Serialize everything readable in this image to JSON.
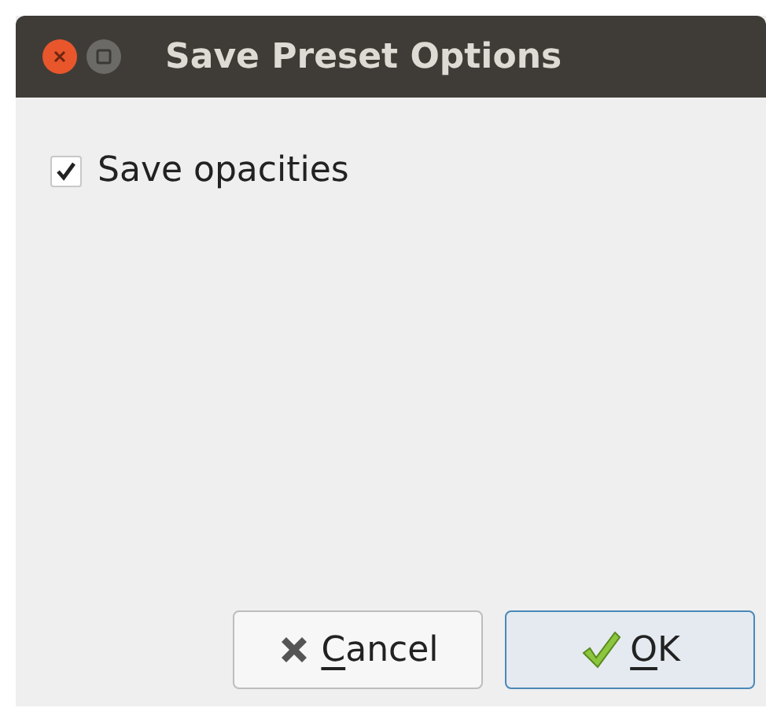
{
  "window": {
    "title": "Save Preset Options"
  },
  "options": [
    {
      "label": "Save opacities",
      "checked": true
    }
  ],
  "buttons": [
    {
      "label": "Cancel",
      "kind": "cancel",
      "mnemonic": true,
      "default": false
    },
    {
      "label": "OK",
      "kind": "ok",
      "mnemonic": true,
      "default": true
    }
  ]
}
